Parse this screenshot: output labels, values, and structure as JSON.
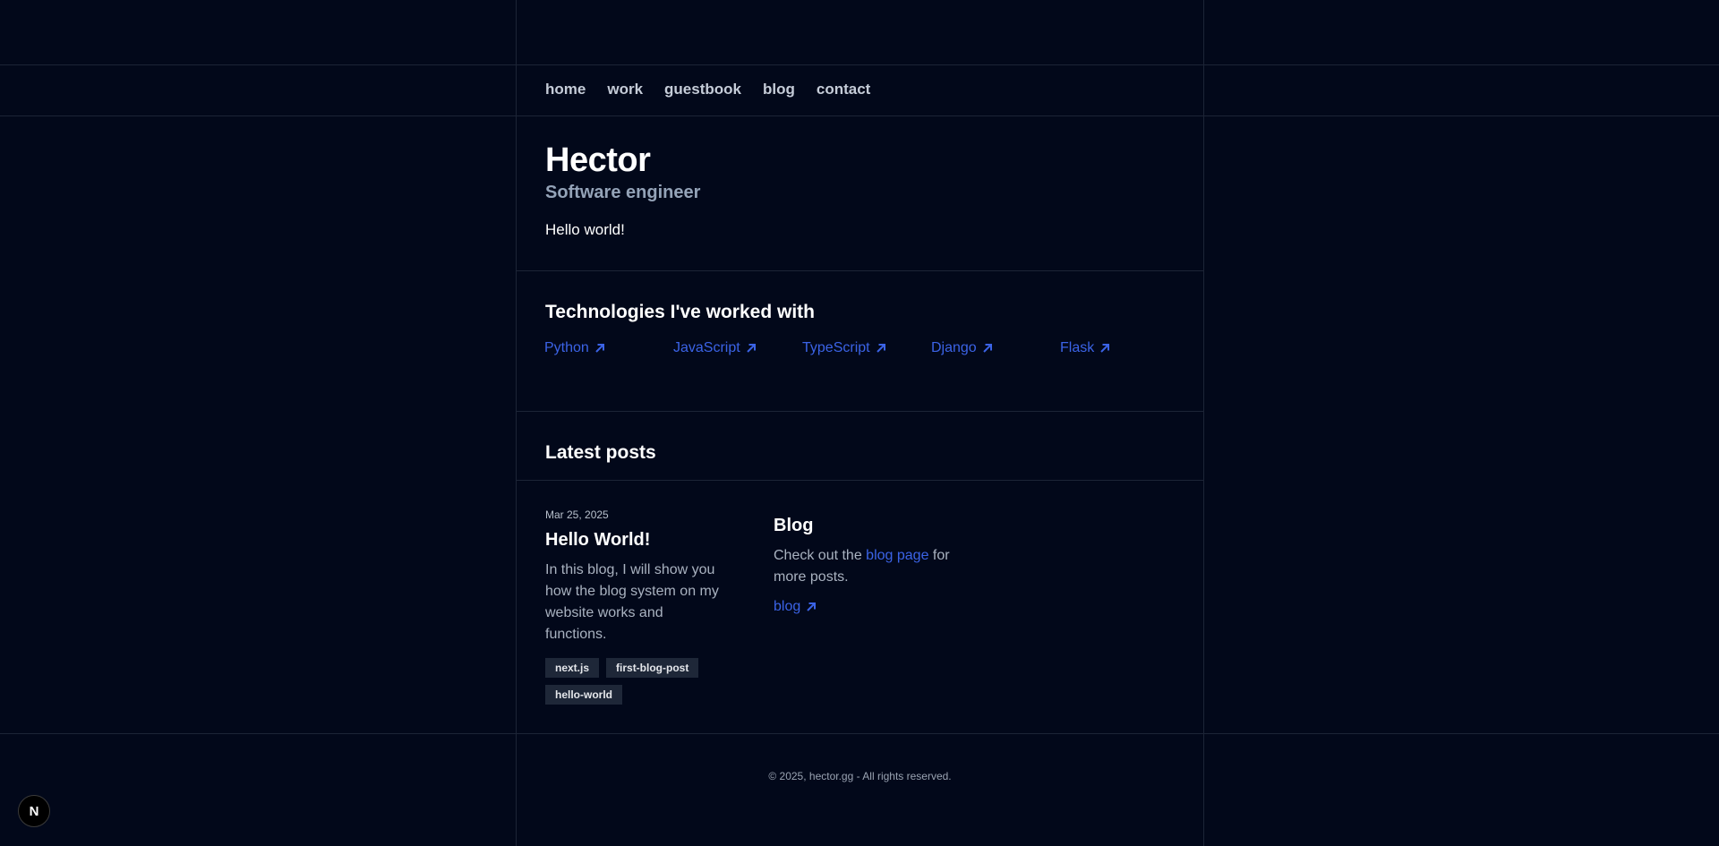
{
  "nav": {
    "items": [
      "home",
      "work",
      "guestbook",
      "blog",
      "contact"
    ]
  },
  "hero": {
    "name": "Hector",
    "role": "Software engineer",
    "intro": "Hello world!"
  },
  "technologies": {
    "title": "Technologies I've worked with",
    "items": [
      "Python",
      "JavaScript",
      "TypeScript",
      "Django",
      "Flask"
    ],
    "icon": "arrow-up-right-icon"
  },
  "latest_posts": {
    "title": "Latest posts",
    "post": {
      "date": "Mar 25, 2025",
      "title": "Hello World!",
      "description": "In this blog, I will show you how the blog system on my website works and functions.",
      "tags": [
        "next.js",
        "first-blog-post",
        "hello-world"
      ]
    },
    "blog_card": {
      "title": "Blog",
      "text_before": "Check out the ",
      "link_text": "blog page",
      "text_after": " for more posts.",
      "link_label": "blog"
    }
  },
  "footer": {
    "text": "© 2025, hector.gg - All rights reserved."
  },
  "nextjs_badge": {
    "label": "N"
  },
  "colors": {
    "background": "#02081a",
    "grid_line": "#1c2436",
    "accent": "#3b63e6",
    "muted": "#94a3b8",
    "tag_bg": "#1e2738"
  }
}
